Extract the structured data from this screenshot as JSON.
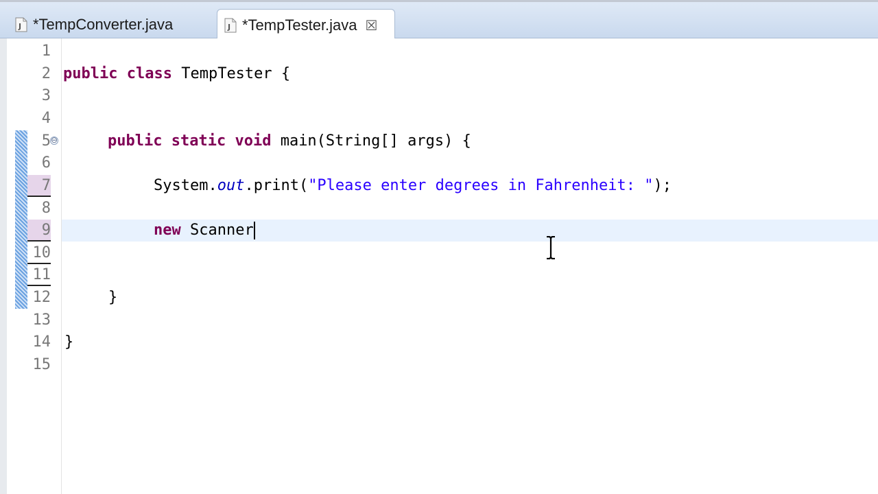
{
  "tabs": [
    {
      "label": "*TempConverter.java",
      "active": false,
      "icon": "java-file-icon"
    },
    {
      "label": "*TempTester.java",
      "active": true,
      "icon": "java-file-icon",
      "close": "☒"
    }
  ],
  "gutter": {
    "line_numbers": [
      "1",
      "2",
      "3",
      "4",
      "5",
      "6",
      "7",
      "8",
      "9",
      "10",
      "11",
      "12",
      "13",
      "14",
      "15"
    ],
    "fold_marker": "⊖"
  },
  "code": {
    "l2": {
      "kw1": "public",
      "kw2": "class",
      "rest": " TempTester {"
    },
    "l5": {
      "kw1": "public",
      "kw2": "static",
      "kw3": "void",
      "rest": " main(String[] args) {"
    },
    "l7": {
      "pre": "System.",
      "field": "out",
      "mid": ".print(",
      "str": "\"Please enter degrees in Fahrenheit: \"",
      "post": ");"
    },
    "l9": {
      "kw": "new",
      "rest": " Scanner"
    },
    "l12": {
      "text": "}"
    },
    "l14": {
      "text": "}"
    }
  },
  "colors": {
    "keyword": "#7f0055",
    "string": "#2a00ff",
    "field": "#0000c0",
    "current_line": "#e8f2fe",
    "changed_line": "#e6d5ea"
  }
}
